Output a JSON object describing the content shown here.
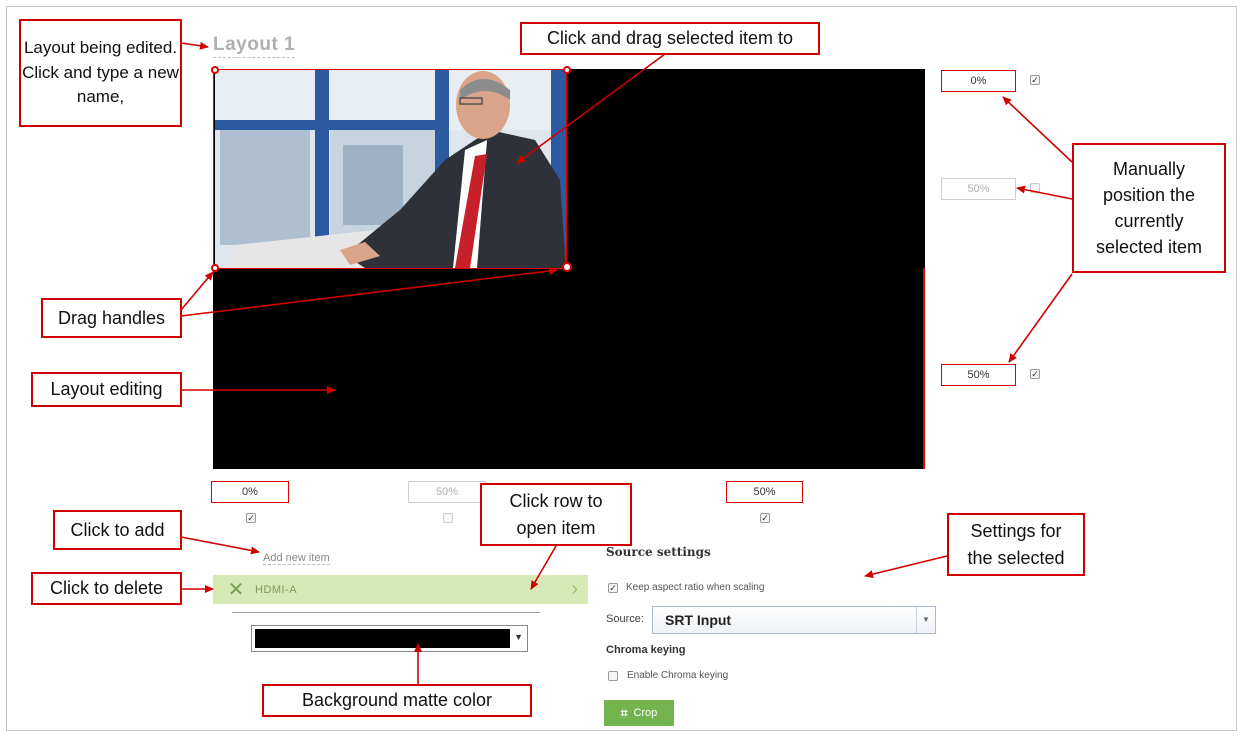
{
  "layout": {
    "title": "Layout 1"
  },
  "position_fields": {
    "right_top": "0%",
    "right_mid": "50%",
    "right_bottom": "50%",
    "bottom_left": "0%",
    "bottom_mid": "50%",
    "bottom_right": "50%"
  },
  "items": {
    "add_new_label": "Add new item",
    "rows": [
      {
        "name": "HDMI-A"
      }
    ]
  },
  "background_matte": {
    "color": "#000000"
  },
  "source_settings": {
    "heading": "Source settings",
    "keep_aspect_label": "Keep aspect ratio when scaling",
    "keep_aspect_checked": true,
    "source_label": "Source:",
    "source_value": "SRT Input",
    "chroma_heading": "Chroma keying",
    "enable_chroma_label": "Enable Chroma keying",
    "enable_chroma_checked": false,
    "crop_label": "Crop"
  },
  "callouts": {
    "layout_being_edited": "Layout being edited. Click and type a new name,",
    "click_drag": "Click and drag selected item to",
    "manually_position": "Manually position the currently selected item",
    "drag_handles": "Drag handles",
    "layout_editing": "Layout editing",
    "click_to_add": "Click to add",
    "click_to_delete": "Click to delete",
    "click_row": "Click row to open item",
    "settings_for_selected": "Settings for the selected",
    "background_matte": "Background matte color"
  },
  "colors": {
    "accent_red": "#d00000",
    "item_row_bg": "#d6e9b4",
    "crop_button": "#74b44e"
  }
}
